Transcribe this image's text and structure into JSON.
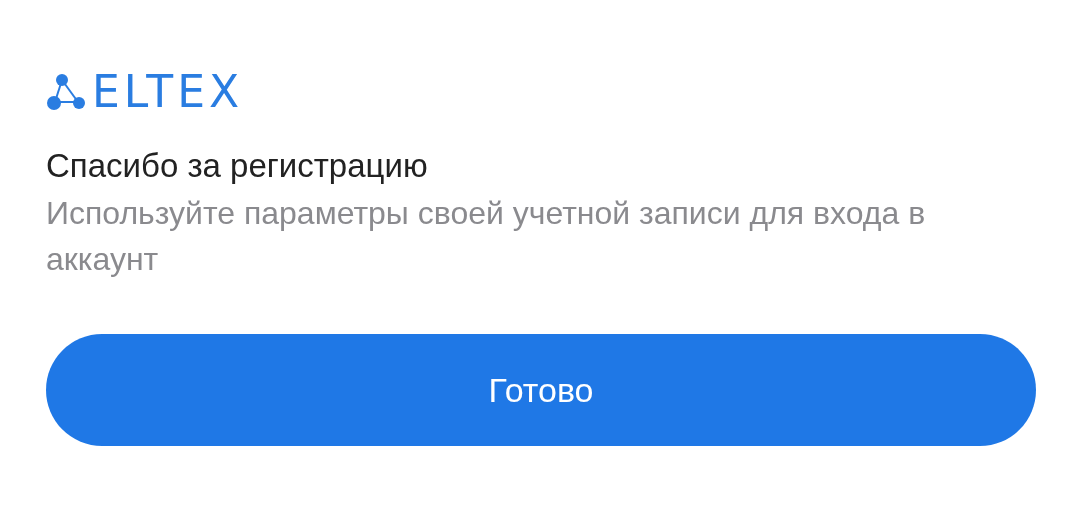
{
  "logo": {
    "text": "ELTEX"
  },
  "title": "Спасибо за регистрацию",
  "message": "Используйте параметры своей учетной записи для входа в аккаунт",
  "button": {
    "label": "Готово"
  }
}
